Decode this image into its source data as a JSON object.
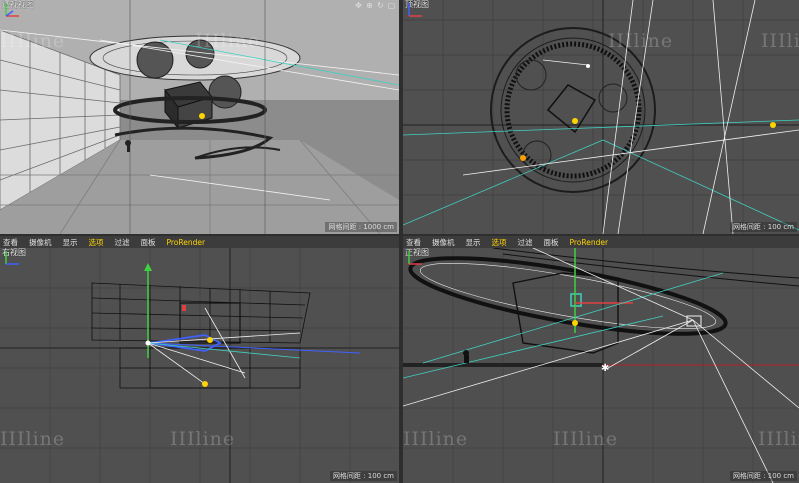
{
  "viewports": {
    "perspective": {
      "label": "透视视图",
      "grid_spacing": "网格间距 : 1000 cm"
    },
    "top": {
      "label": "顶视图",
      "grid_spacing": "网格间距 : 100 cm"
    },
    "right": {
      "label": "右视图",
      "grid_spacing": "网格间距 : 100 cm"
    },
    "front": {
      "label": "正视图",
      "grid_spacing": "网格间距 : 100 cm"
    }
  },
  "menu_left": [
    "查看",
    "摄像机",
    "显示",
    "选项",
    "过滤",
    "面板",
    "ProRender"
  ],
  "menu_right": [
    "查看",
    "摄像机",
    "显示",
    "选项",
    "过滤",
    "面板",
    "ProRender"
  ],
  "active_menu": "选项",
  "nav_icons": [
    "move-view-icon",
    "zoom-view-icon",
    "rotate-view-icon",
    "maximize-view-icon"
  ],
  "nav_glyphs": [
    "✥",
    "⊕",
    "↻",
    "▢"
  ],
  "watermark": "IIIline",
  "colors": {
    "accent": "#ffd400",
    "axis_x": "#e04040",
    "axis_y": "#40d040",
    "axis_z": "#4060ff",
    "cyan": "#40d0c0"
  }
}
